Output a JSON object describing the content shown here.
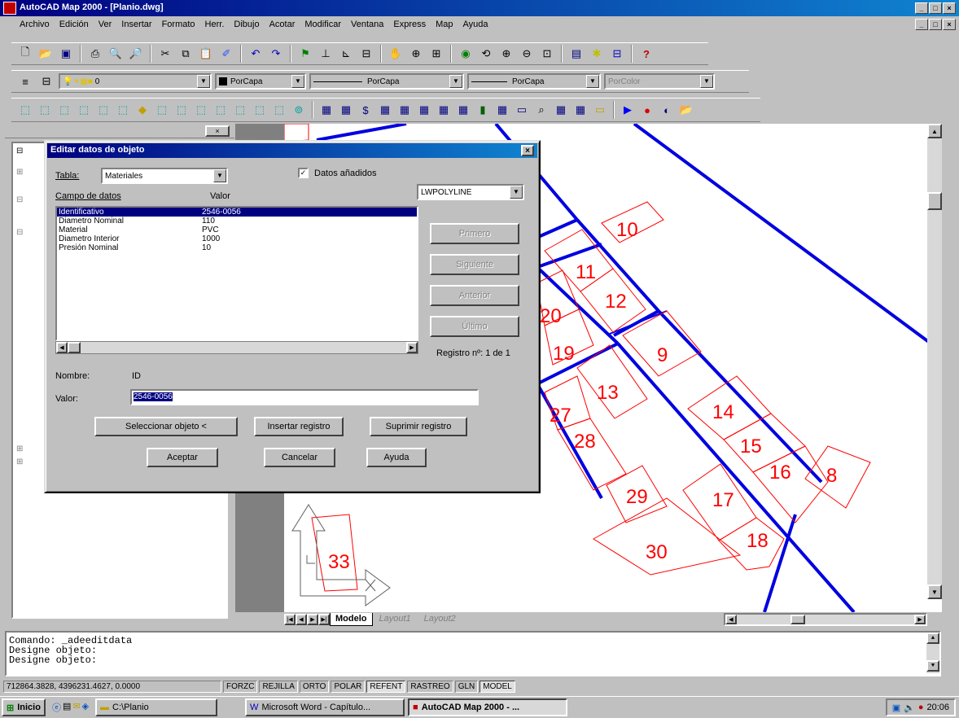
{
  "window": {
    "title": "AutoCAD Map 2000 - [Planio.dwg]",
    "controls": [
      "_",
      "□",
      "×"
    ]
  },
  "menu": [
    "Archivo",
    "Edición",
    "Ver",
    "Insertar",
    "Formato",
    "Herr.",
    "Dibujo",
    "Acotar",
    "Modificar",
    "Ventana",
    "Express",
    "Map",
    "Ayuda"
  ],
  "toolbar_layers": {
    "layer_value": "0",
    "color_value": "PorCapa",
    "linetype_value": "PorCapa",
    "lineweight_value": "PorCapa",
    "plotstyle_value": "PorColor"
  },
  "dialog": {
    "title": "Editar datos de objeto",
    "close_label": "×",
    "table_label": "Tabla:",
    "table_value": "Materiales",
    "attached_checkbox_label": "Datos añadidos",
    "entity_value": "LWPOLYLINE",
    "col_field": "Campo de datos",
    "col_value": "Valor",
    "rows": [
      {
        "field": "Identificativo",
        "value": "2546-0056"
      },
      {
        "field": "Diametro Nominal",
        "value": "110"
      },
      {
        "field": "Material",
        "value": "PVC"
      },
      {
        "field": "Diametro Interior",
        "value": "1000"
      },
      {
        "field": "Presión Nominal",
        "value": "10"
      }
    ],
    "side_buttons": [
      "Primero",
      "Siguiente",
      "Anterior",
      "Último"
    ],
    "record_label": "Registro nº: 1 de 1",
    "name_label": "Nombre:",
    "name_value": "ID",
    "value_label": "Valor:",
    "value_input": "2546-0056",
    "btn_select": "Seleccionar objeto <",
    "btn_insert": "Insertar registro",
    "btn_delete": "Suprimir registro",
    "btn_ok": "Aceptar",
    "btn_cancel": "Cancelar",
    "btn_help": "Ayuda"
  },
  "drawing": {
    "parcels": [
      "10",
      "11",
      "12",
      "20",
      "19",
      "9",
      "13",
      "27",
      "28",
      "14",
      "15",
      "16",
      "8",
      "29",
      "17",
      "18",
      "30",
      "33"
    ],
    "tabs": [
      "Modelo",
      "Layout1",
      "Layout2"
    ]
  },
  "command_line": [
    "Comando: _adeeditdata",
    "Designe objeto:",
    "Designe objeto:"
  ],
  "status": {
    "coords": "712864.3828, 4396231.4627, 0.0000",
    "toggles": [
      "FORZC",
      "REJILLA",
      "ORTO",
      "POLAR",
      "REFENT",
      "RASTREO",
      "GLN",
      "MODEL"
    ]
  },
  "taskbar": {
    "start": "Inicio",
    "tasks": [
      "C:\\Planio",
      "Microsoft Word - Capítulo...",
      "AutoCAD Map 2000 - ..."
    ],
    "clock": "20:06"
  }
}
